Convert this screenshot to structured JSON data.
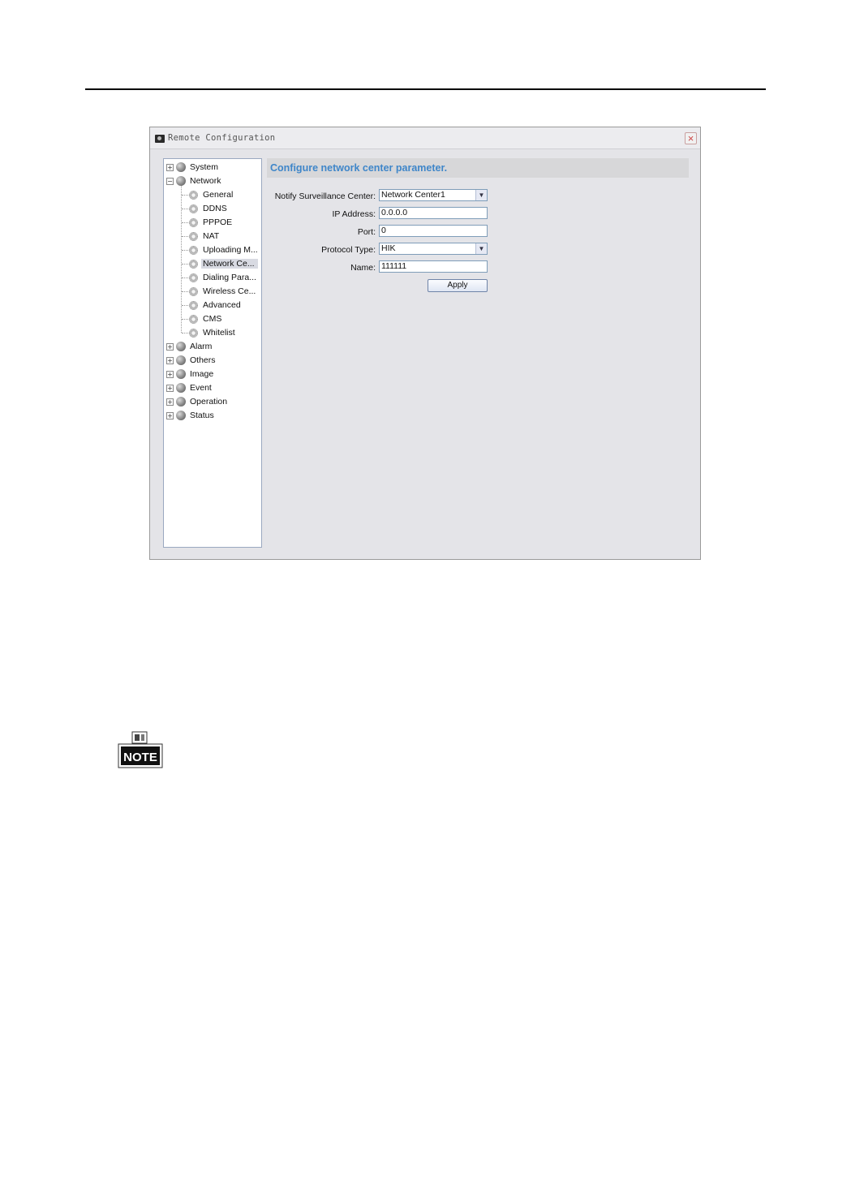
{
  "window": {
    "title": "Remote Configuration",
    "close_label": "×"
  },
  "tree": {
    "items": [
      {
        "label": "System",
        "level": 0,
        "expander": "+"
      },
      {
        "label": "Network",
        "level": 0,
        "expander": "−"
      },
      {
        "label": "General",
        "level": 1
      },
      {
        "label": "DDNS",
        "level": 1
      },
      {
        "label": "PPPOE",
        "level": 1
      },
      {
        "label": "NAT",
        "level": 1
      },
      {
        "label": "Uploading M...",
        "level": 1
      },
      {
        "label": "Network Ce...",
        "level": 1,
        "selected": true
      },
      {
        "label": "Dialing Para...",
        "level": 1
      },
      {
        "label": "Wireless Ce...",
        "level": 1
      },
      {
        "label": "Advanced",
        "level": 1
      },
      {
        "label": "CMS",
        "level": 1
      },
      {
        "label": "Whitelist",
        "level": 1
      },
      {
        "label": "Alarm",
        "level": 0,
        "expander": "+"
      },
      {
        "label": "Others",
        "level": 0,
        "expander": "+"
      },
      {
        "label": "Image",
        "level": 0,
        "expander": "+"
      },
      {
        "label": "Event",
        "level": 0,
        "expander": "+"
      },
      {
        "label": "Operation",
        "level": 0,
        "expander": "+"
      },
      {
        "label": "Status",
        "level": 0,
        "expander": "+"
      }
    ]
  },
  "panel": {
    "title": "Configure network center parameter."
  },
  "form": {
    "notify_label": "Notify Surveillance Center:",
    "notify_value": "Network Center1",
    "ip_label": "IP Address:",
    "ip_value": "0.0.0.0",
    "port_label": "Port:",
    "port_value": "0",
    "protocol_label": "Protocol Type:",
    "protocol_value": "HIK",
    "name_label": "Name:",
    "name_value": "111111",
    "apply_label": "Apply"
  },
  "note": {
    "label": "NOTE"
  }
}
